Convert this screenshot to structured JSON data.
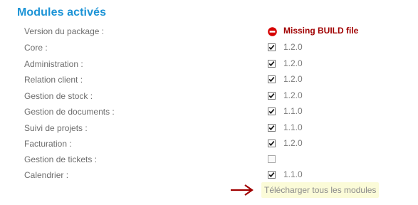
{
  "section": {
    "title": "Modules activés"
  },
  "package": {
    "label": "Version du package :",
    "error_text": "Missing BUILD file",
    "error_color": "#a00000"
  },
  "modules": [
    {
      "label": "Core :",
      "checked": true,
      "version": "1.2.0"
    },
    {
      "label": "Administration :",
      "checked": true,
      "version": "1.2.0"
    },
    {
      "label": "Relation client :",
      "checked": true,
      "version": "1.2.0"
    },
    {
      "label": "Gestion de stock :",
      "checked": true,
      "version": "1.2.0"
    },
    {
      "label": "Gestion de documents :",
      "checked": true,
      "version": "1.1.0"
    },
    {
      "label": "Suivi de projets :",
      "checked": true,
      "version": "1.1.0"
    },
    {
      "label": "Facturation :",
      "checked": true,
      "version": "1.2.0"
    },
    {
      "label": "Gestion de tickets :",
      "checked": false,
      "version": ""
    },
    {
      "label": "Calendrier :",
      "checked": true,
      "version": "1.1.0"
    }
  ],
  "download": {
    "label": "Télécharger tous les modules",
    "arrow_icon": "arrow-right-icon",
    "highlight_color": "#fbfbd8",
    "arrow_color": "#a00000"
  },
  "colors": {
    "title": "#1b93d6",
    "label": "#6d6d6d"
  }
}
